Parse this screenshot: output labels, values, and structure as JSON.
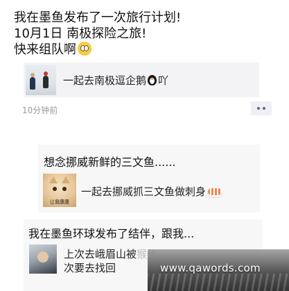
{
  "post1": {
    "text_line1": "我在墨鱼发布了一次旅行计划!",
    "text_line2": "10月1日 南极探险之旅!",
    "text_line3": "快来组队啊",
    "link_title": "一起去南极逗企鹅",
    "link_suffix": "吖",
    "time": "10分钟前",
    "icons": [
      "smiley-face-icon",
      "penguin-icon",
      "more-dots-icon"
    ]
  },
  "post2": {
    "title": "想念挪威新鲜的三文鱼......",
    "thumb_caption": "让我康康",
    "link_title": "一起去挪威抓三文鱼做刺身",
    "icons": [
      "sushi-icon"
    ]
  },
  "post3": {
    "title": "我在墨鱼环球发布了结伴，跟我...",
    "link_line1": "上次去峨眉山被",
    "link_line1_obscured": "猴子",
    "link_line2": "次要去找回"
  },
  "watermark": {
    "text": "www.qawords.com"
  }
}
